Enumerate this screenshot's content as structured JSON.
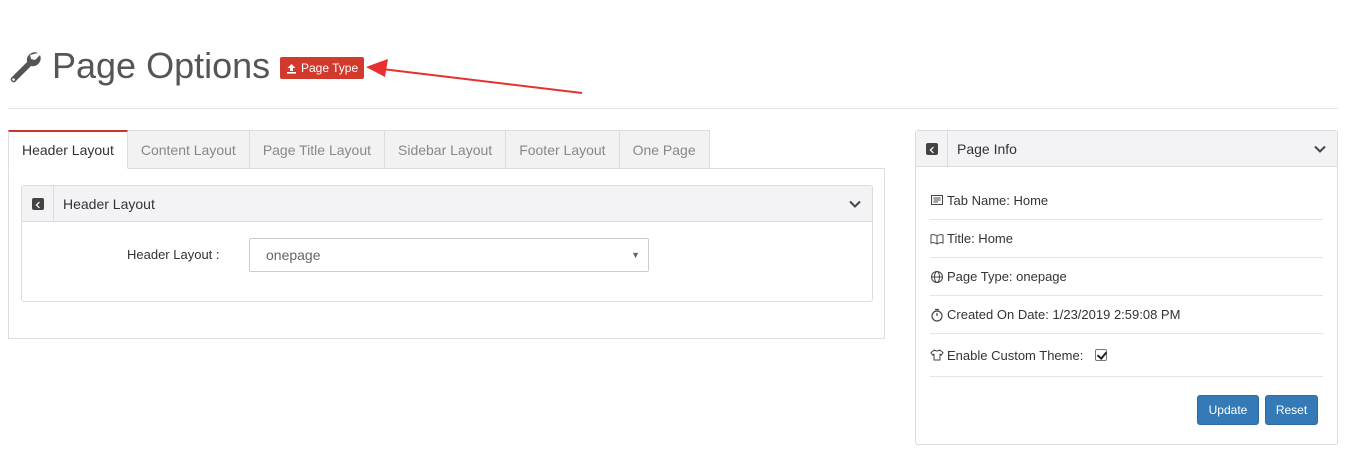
{
  "header": {
    "title": "Page Options",
    "badge_label": "Page Type"
  },
  "tabs": [
    {
      "label": "Header Layout",
      "active": true
    },
    {
      "label": "Content Layout",
      "active": false
    },
    {
      "label": "Page Title Layout",
      "active": false
    },
    {
      "label": "Sidebar Layout",
      "active": false
    },
    {
      "label": "Footer Layout",
      "active": false
    },
    {
      "label": "One Page",
      "active": false
    }
  ],
  "header_layout_panel": {
    "title": "Header Layout",
    "field_label": "Header Layout :",
    "select_value": "onepage"
  },
  "page_info": {
    "title": "Page Info",
    "tab_name": "Tab Name: Home",
    "page_title": "Title: Home",
    "page_type": "Page Type: onepage",
    "created": "Created On Date: 1/23/2019 2:59:08 PM",
    "custom_theme_label": "Enable Custom Theme:",
    "custom_theme_checked": true,
    "update_label": "Update",
    "reset_label": "Reset"
  },
  "colors": {
    "accent_red": "#d23a2e",
    "button_blue": "#337ab7",
    "arrow_red": "#e8312f"
  },
  "icons": [
    "wrench-icon",
    "upload-icon",
    "expand-icon",
    "chevron-down-icon",
    "newspaper-icon",
    "book-icon",
    "globe-icon",
    "stopwatch-icon",
    "tshirt-icon"
  ]
}
